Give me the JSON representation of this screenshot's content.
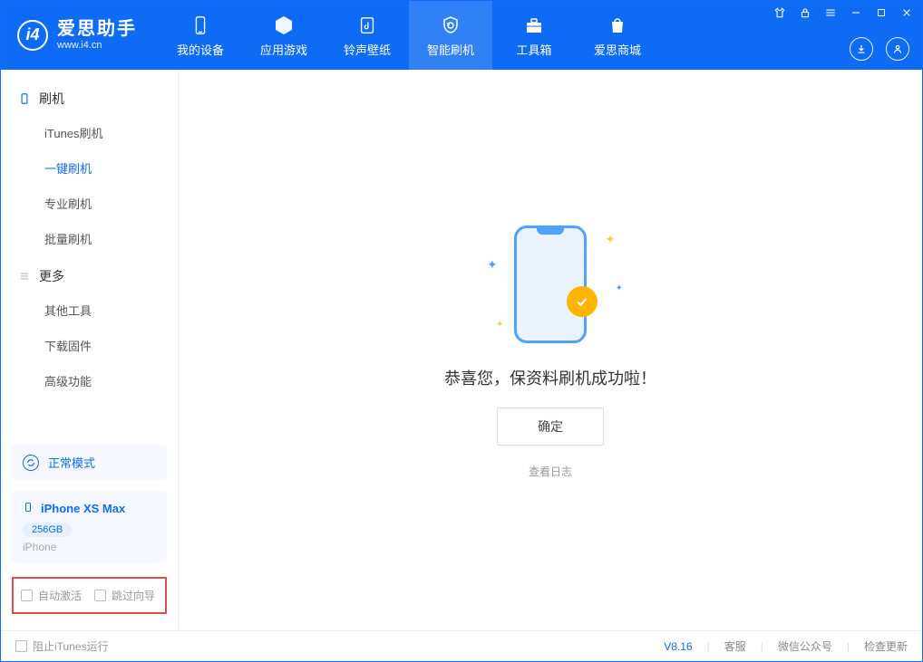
{
  "app": {
    "title": "爱思助手",
    "subtitle": "www.i4.cn"
  },
  "tabs": [
    {
      "label": "我的设备"
    },
    {
      "label": "应用游戏"
    },
    {
      "label": "铃声壁纸"
    },
    {
      "label": "智能刷机"
    },
    {
      "label": "工具箱"
    },
    {
      "label": "爱思商城"
    }
  ],
  "sidebar": {
    "group1_title": "刷机",
    "group1_items": [
      "iTunes刷机",
      "一键刷机",
      "专业刷机",
      "批量刷机"
    ],
    "group2_title": "更多",
    "group2_items": [
      "其他工具",
      "下载固件",
      "高级功能"
    ],
    "mode_label": "正常模式",
    "device": {
      "name": "iPhone XS Max",
      "storage": "256GB",
      "type": "iPhone"
    },
    "check_auto_activate": "自动激活",
    "check_skip_wizard": "跳过向导"
  },
  "main": {
    "success_message": "恭喜您，保资料刷机成功啦！",
    "ok_button": "确定",
    "view_log": "查看日志"
  },
  "statusbar": {
    "block_itunes": "阻止iTunes运行",
    "version": "V8.16",
    "support": "客服",
    "wechat": "微信公众号",
    "check_update": "检查更新"
  }
}
